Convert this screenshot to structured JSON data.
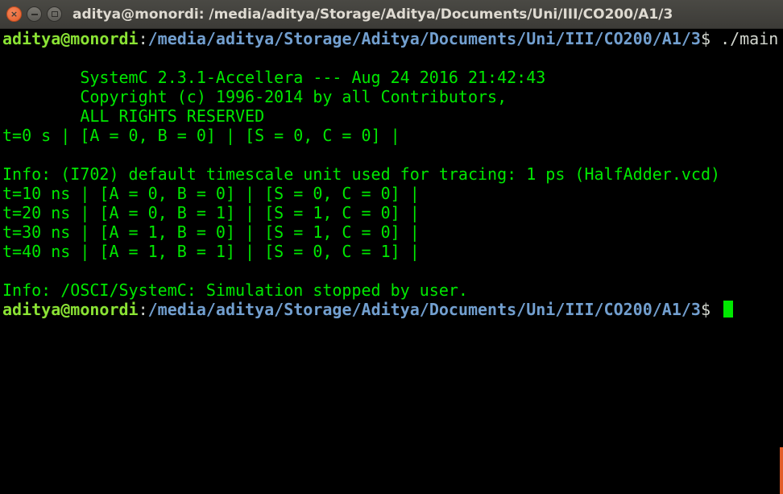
{
  "window": {
    "title": "aditya@monordi: /media/aditya/Storage/Aditya/Documents/Uni/III/CO200/A1/3",
    "close_glyph": "×",
    "colors": {
      "prompt_user": "#8ae234",
      "prompt_path": "#729fcf",
      "output": "#00e800",
      "background": "#000000"
    }
  },
  "terminal": {
    "prompt_user": "aditya@monordi",
    "prompt_colon": ":",
    "prompt_path": "/media/aditya/Storage/Aditya/Documents/Uni/III/CO200/A1/3",
    "prompt_symbol": "$ ",
    "command": "./main",
    "lines": [
      "",
      "        SystemC 2.3.1-Accellera --- Aug 24 2016 21:42:43",
      "        Copyright (c) 1996-2014 by all Contributors,",
      "        ALL RIGHTS RESERVED",
      "t=0 s | [A = 0, B = 0] | [S = 0, C = 0] |",
      "",
      "Info: (I702) default timescale unit used for tracing: 1 ps (HalfAdder.vcd)",
      "t=10 ns | [A = 0, B = 0] | [S = 0, C = 0] |",
      "t=20 ns | [A = 0, B = 1] | [S = 1, C = 0] |",
      "t=30 ns | [A = 1, B = 0] | [S = 1, C = 0] |",
      "t=40 ns | [A = 1, B = 1] | [S = 0, C = 1] |",
      "",
      "Info: /OSCI/SystemC: Simulation stopped by user."
    ]
  }
}
